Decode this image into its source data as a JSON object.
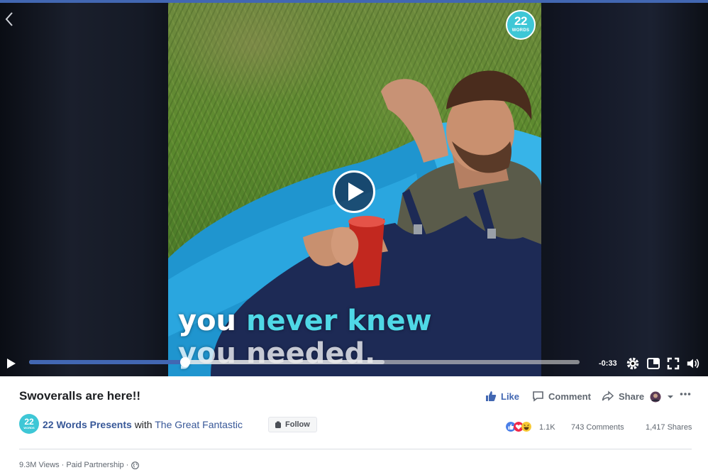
{
  "video": {
    "caption_line1_a": "you",
    "caption_line1_b": "never knew",
    "caption_line2": "you needed.",
    "badge_number": "22",
    "badge_word": "WORDS",
    "time_remaining": "-0:33",
    "progress_fraction": 0.284,
    "buffered_fraction": 0.645
  },
  "post": {
    "title": "Swoveralls are here!!",
    "publisher_logo_number": "22",
    "publisher_logo_word": "WORDS",
    "publisher": "22 Words Presents",
    "with_text": "with",
    "partner": "The Great Fantastic",
    "follow_label": "Follow",
    "views": "9.3M Views",
    "paid": "Paid Partnership",
    "dot": "·"
  },
  "actions": {
    "like": "Like",
    "comment": "Comment",
    "share": "Share"
  },
  "stats": {
    "reactions": "1.1K",
    "comments": "743 Comments",
    "shares": "1,417 Shares"
  },
  "colors": {
    "brand_blue": "#4267b2",
    "badge_teal": "#3ec7d6",
    "caption_highlight": "#4fd8e6"
  },
  "icons": [
    "back-chevron-icon",
    "play-icon",
    "gear-icon",
    "pip-icon",
    "fullscreen-icon",
    "volume-icon",
    "like-thumb-icon",
    "comment-bubble-icon",
    "share-arrow-icon",
    "globe-icon"
  ]
}
